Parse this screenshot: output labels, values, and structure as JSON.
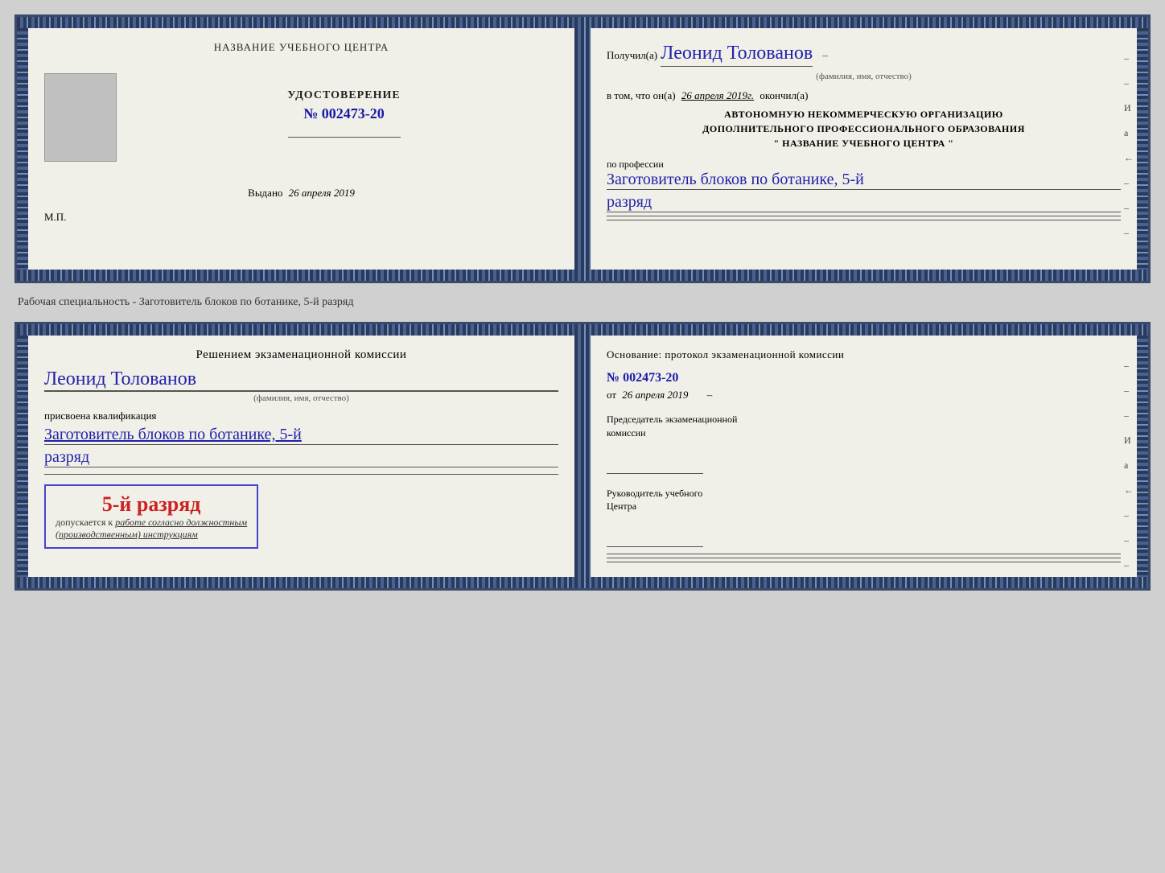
{
  "page": {
    "background": "#d0d0d0"
  },
  "card1": {
    "left": {
      "center_title": "НАЗВАНИЕ УЧЕБНОГО ЦЕНТРА",
      "cert_title": "УДОСТОВЕРЕНИЕ",
      "cert_number": "№ 002473-20",
      "issued_label": "Выдано",
      "issued_date": "26 апреля 2019",
      "mp_label": "М.П."
    },
    "right": {
      "received_prefix": "Получил(а)",
      "received_name": "Леонид Толованов",
      "name_subtitle": "(фамилия, имя, отчество)",
      "certified_text": "в том, что он(а)",
      "certified_date": "26 апреля 2019г.",
      "certified_suffix": "окончил(а)",
      "org_line1": "АВТОНОМНУЮ НЕКОММЕРЧЕСКУЮ ОРГАНИЗАЦИЮ",
      "org_line2": "ДОПОЛНИТЕЛЬНОГО ПРОФЕССИОНАЛЬНОГО ОБРАЗОВАНИЯ",
      "org_line3": "\" НАЗВАНИЕ УЧЕБНОГО ЦЕНТРА \"",
      "profession_label": "по профессии",
      "profession_name": "Заготовитель блоков по ботанике, 5-й",
      "razryad": "разряд",
      "side_chars": [
        "–",
        "–",
        "И",
        "а",
        "←",
        "–",
        "–",
        "–"
      ]
    }
  },
  "specialty_label": "Рабочая специальность - Заготовитель блоков по ботанике, 5-й разряд",
  "card2": {
    "left": {
      "commission_title": "Решением экзаменационной комиссии",
      "person_name": "Леонид Толованов",
      "name_subtitle": "(фамилия, имя, отчество)",
      "qualification_label": "присвоена квалификация",
      "qualification_name": "Заготовитель блоков по ботанике, 5-й",
      "razryad": "разряд",
      "stamp_rank": "5-й разряд",
      "stamp_desc1": "допускается к",
      "stamp_desc2": "работе согласно должностным",
      "stamp_desc3": "(производственным) инструкциям"
    },
    "right": {
      "basis_title": "Основание: протокол экзаменационной комиссии",
      "protocol_number": "№ 002473-20",
      "date_prefix": "от",
      "protocol_date": "26 апреля 2019",
      "chairman_title": "Председатель экзаменационной",
      "chairman_subtitle": "комиссии",
      "director_title": "Руководитель учебного",
      "director_subtitle": "Центра",
      "side_chars": [
        "–",
        "–",
        "–",
        "И",
        "а",
        "←",
        "–",
        "–",
        "–",
        "–"
      ]
    }
  }
}
